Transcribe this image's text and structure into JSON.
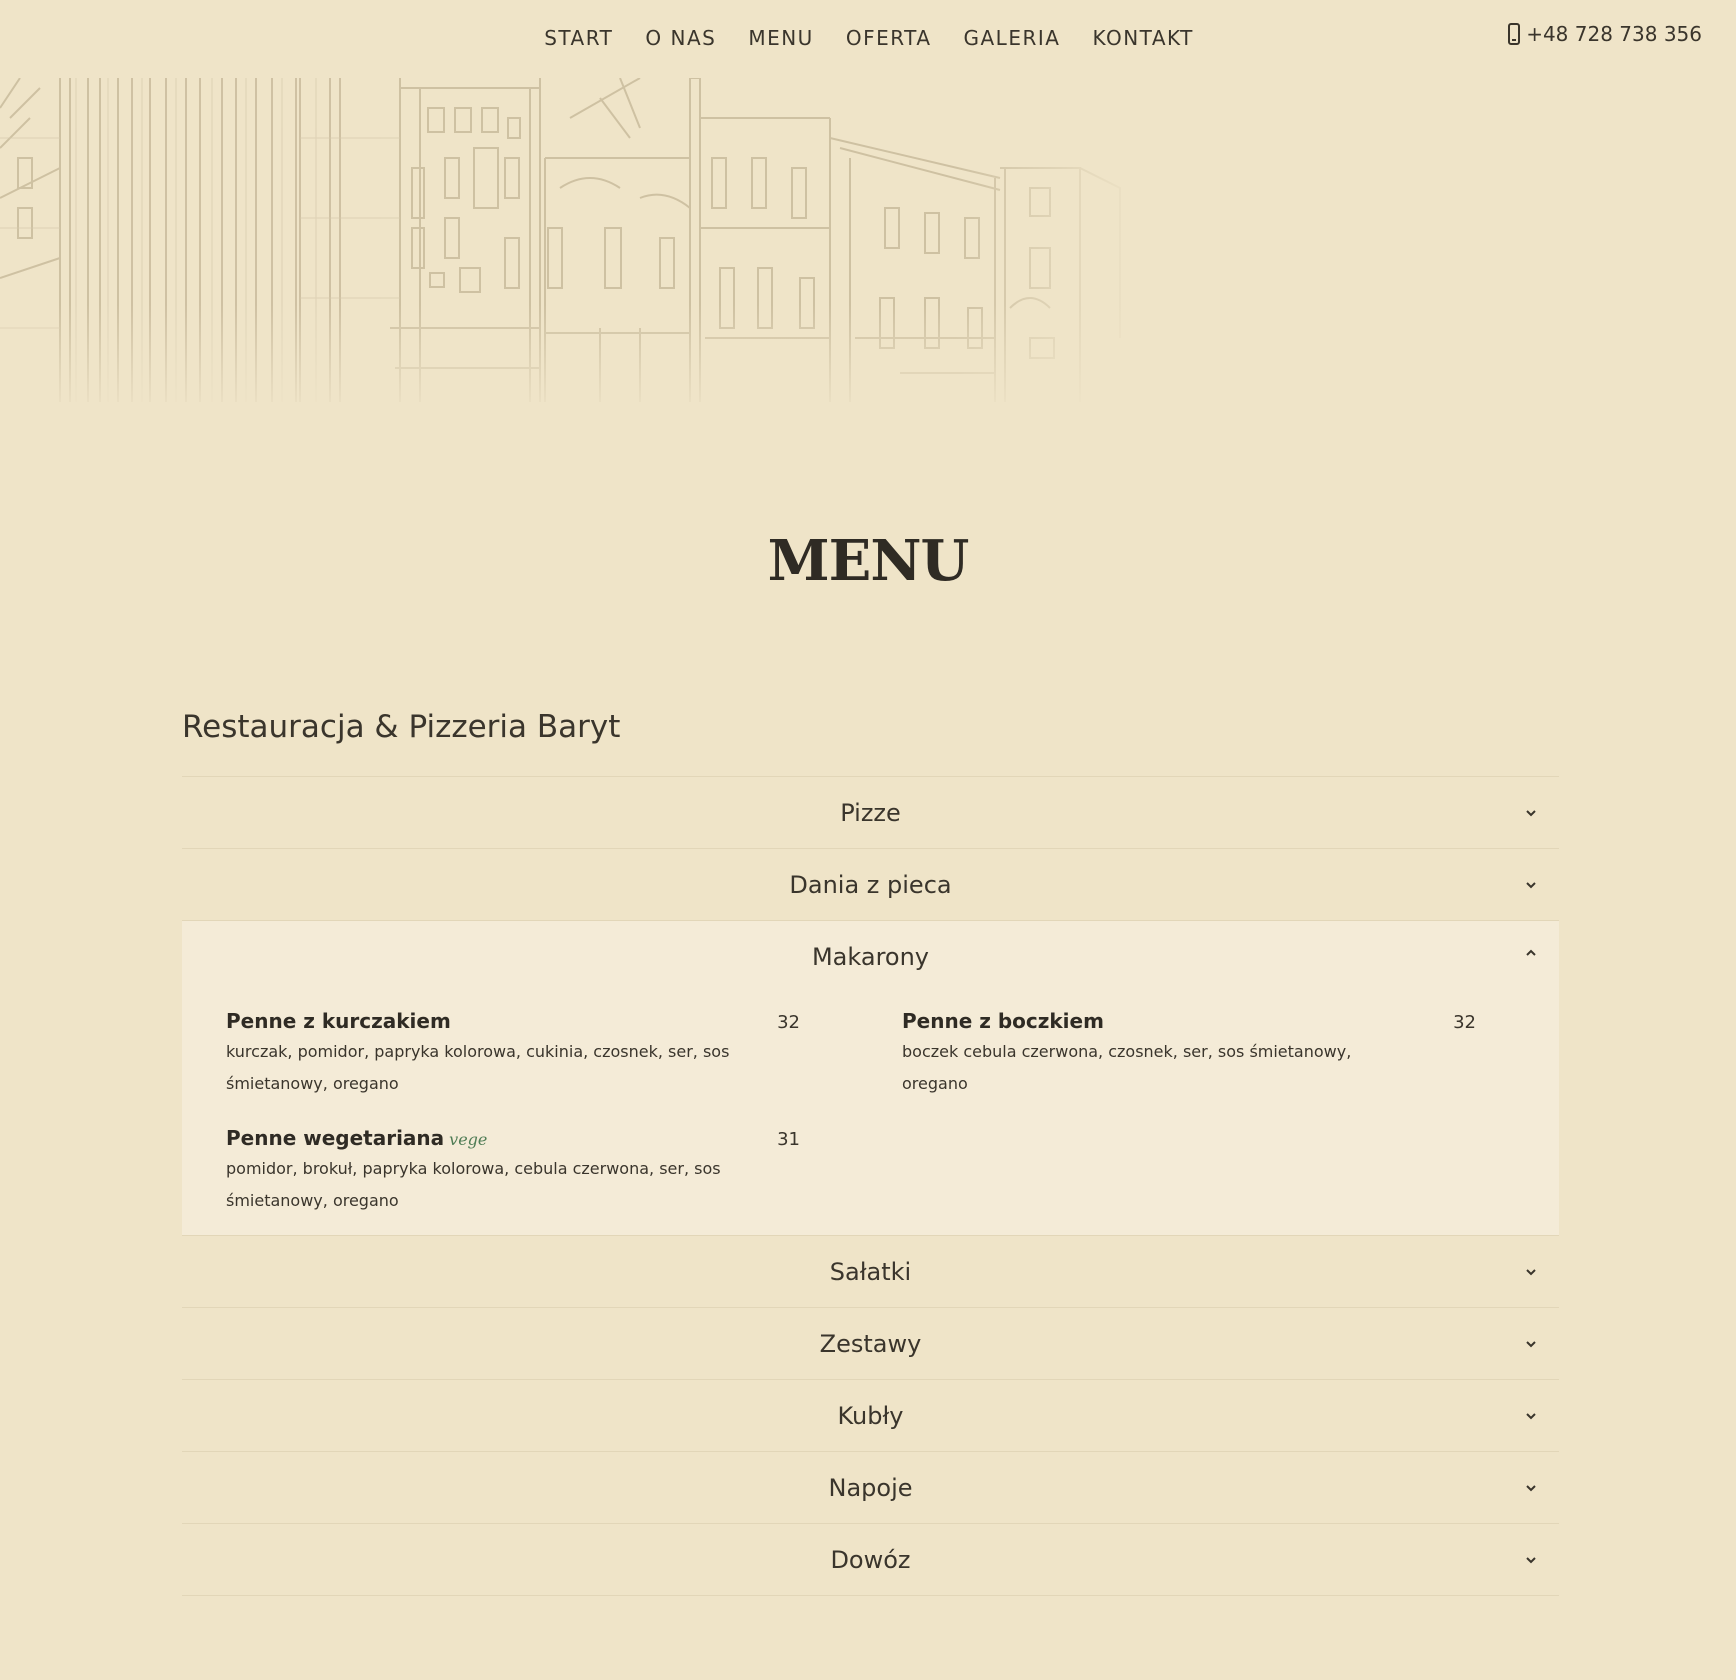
{
  "nav": {
    "items": [
      "START",
      "O NAS",
      "MENU",
      "OFERTA",
      "GALERIA",
      "KONTAKT"
    ],
    "phone": "+48 728 738 356",
    "phone_icon": "mobile-phone-icon"
  },
  "page": {
    "title": "MENU",
    "restaurant_name": "Restauracja & Pizzeria Baryt"
  },
  "colors": {
    "background": "#efe4c8",
    "open_panel": "#f4ebd7",
    "text": "#3a352c",
    "vege_tag": "#4f7c55"
  },
  "menu": {
    "categories": [
      {
        "label": "Pizze",
        "open": false
      },
      {
        "label": "Dania z pieca",
        "open": false
      },
      {
        "label": "Makarony",
        "open": true,
        "dishes": [
          {
            "name": "Penne z kurczakiem",
            "tag": "",
            "price": "32",
            "description": "kurczak, pomidor, papryka kolorowa, cukinia, czosnek, ser, sos śmietanowy, oregano"
          },
          {
            "name": "Penne z boczkiem",
            "tag": "",
            "price": "32",
            "description": "boczek cebula czerwona, czosnek, ser, sos śmietanowy, oregano"
          },
          {
            "name": "Penne wegetariana",
            "tag": "vege",
            "price": "31",
            "description": "pomidor, brokuł, papryka kolorowa, cebula czerwona, ser, sos śmietanowy, oregano"
          }
        ]
      },
      {
        "label": "Sałatki",
        "open": false
      },
      {
        "label": "Zestawy",
        "open": false
      },
      {
        "label": "Kubły",
        "open": false
      },
      {
        "label": "Napoje",
        "open": false
      },
      {
        "label": "Dowóz",
        "open": false
      }
    ]
  }
}
